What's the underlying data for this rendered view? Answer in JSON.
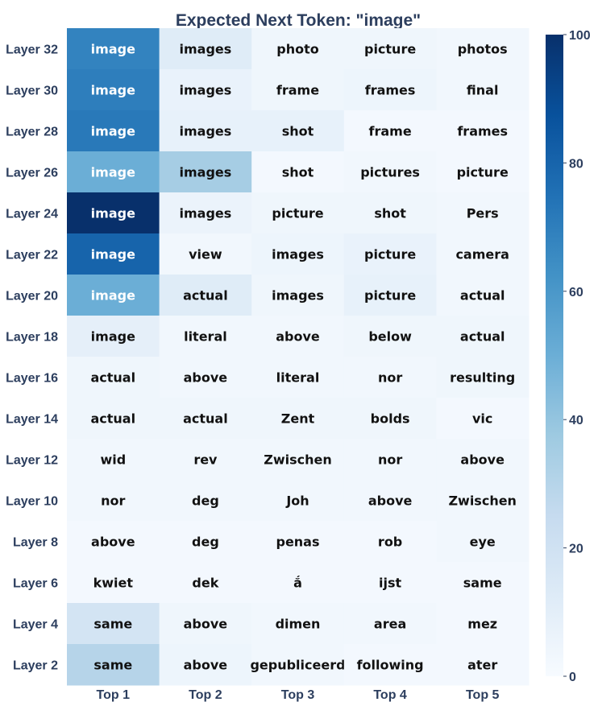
{
  "chart_data": {
    "type": "heatmap",
    "title": "Expected Next Token: \"image\"",
    "columns": [
      "Top 1",
      "Top 2",
      "Top 3",
      "Top 4",
      "Top 5"
    ],
    "rows": [
      "Layer 32",
      "Layer 30",
      "Layer 28",
      "Layer 26",
      "Layer 24",
      "Layer 22",
      "Layer 20",
      "Layer 18",
      "Layer 16",
      "Layer 14",
      "Layer 12",
      "Layer 10",
      "Layer 8",
      "Layer 6",
      "Layer 4",
      "Layer 2"
    ],
    "tokens": [
      [
        "image",
        "images",
        "photo",
        "picture",
        "photos"
      ],
      [
        "image",
        "images",
        "frame",
        "frames",
        "final"
      ],
      [
        "image",
        "images",
        "shot",
        "frame",
        "frames"
      ],
      [
        "image",
        "images",
        "shot",
        "pictures",
        "picture"
      ],
      [
        "image",
        "images",
        "picture",
        "shot",
        "Pers"
      ],
      [
        "image",
        "view",
        "images",
        "picture",
        "camera"
      ],
      [
        "image",
        "actual",
        "images",
        "picture",
        "actual"
      ],
      [
        "image",
        "literal",
        "above",
        "below",
        "actual"
      ],
      [
        "actual",
        "above",
        "literal",
        "nor",
        "resulting"
      ],
      [
        "actual",
        "actual",
        "Zent",
        "bolds",
        "vic"
      ],
      [
        "wid",
        "rev",
        "Zwischen",
        "nor",
        "above"
      ],
      [
        "nor",
        "deg",
        "Joh",
        "above",
        "Zwischen"
      ],
      [
        "above",
        "deg",
        "penas",
        "rob",
        "eye"
      ],
      [
        "kwiet",
        "dek",
        "ắ",
        "ijst",
        "same"
      ],
      [
        "same",
        "above",
        "dimen",
        "area",
        "mez"
      ],
      [
        "same",
        "above",
        "gepubliceerd",
        "following",
        "ater"
      ]
    ],
    "values": [
      [
        68,
        12,
        4,
        4,
        3
      ],
      [
        70,
        7,
        4,
        5,
        3
      ],
      [
        72,
        8,
        8,
        2,
        2
      ],
      [
        50,
        35,
        2,
        3,
        2
      ],
      [
        100,
        6,
        4,
        4,
        3
      ],
      [
        80,
        3,
        5,
        7,
        3
      ],
      [
        50,
        12,
        4,
        8,
        3
      ],
      [
        9,
        3,
        3,
        4,
        4
      ],
      [
        4,
        3,
        3,
        3,
        4
      ],
      [
        4,
        4,
        4,
        4,
        2
      ],
      [
        3,
        3,
        3,
        3,
        3
      ],
      [
        3,
        3,
        3,
        3,
        3
      ],
      [
        2,
        2,
        2,
        2,
        3
      ],
      [
        2,
        2,
        2,
        2,
        2
      ],
      [
        18,
        4,
        3,
        3,
        2
      ],
      [
        30,
        5,
        3,
        2,
        2
      ]
    ],
    "colorbar": {
      "min": 0,
      "max": 100,
      "ticks": [
        0,
        20,
        40,
        60,
        80,
        100
      ],
      "colormap": "Blues"
    },
    "colors": {
      "low": "#f7fbff",
      "high": "#08306b",
      "label": "#2c3e5e"
    }
  }
}
